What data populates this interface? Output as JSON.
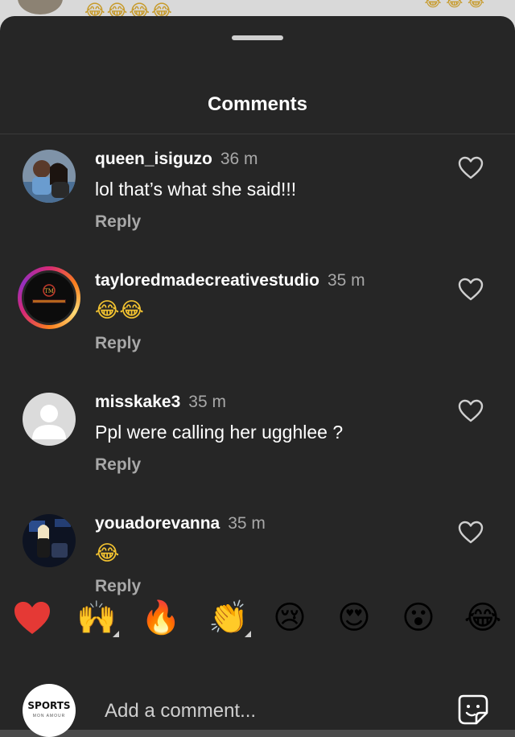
{
  "peek": {
    "emojis_left": "😂😂😂😂",
    "emojis_right": "😂 😂 😂"
  },
  "sheet": {
    "title": "Comments"
  },
  "comments": [
    {
      "username": "queen_isiguzo",
      "time": "36 m",
      "text": "lol that’s what she said!!!",
      "reply_label": "Reply",
      "avatar": "couple-photo"
    },
    {
      "username": "tayloredmadecreativestudio",
      "time": "35 m",
      "text": "😂😂",
      "reply_label": "Reply",
      "avatar": "studio-logo-with-story-ring",
      "avatar_logo_text": "TAYLOREDMADE ART"
    },
    {
      "username": "misskake3",
      "time": "35 m",
      "text": "Ppl were calling her ugghlee ?",
      "reply_label": "Reply",
      "avatar": "default-person"
    },
    {
      "username": "youadorevanna",
      "time": "35 m",
      "text": "😂",
      "reply_label": "Reply",
      "avatar": "studio-photo"
    }
  ],
  "reactions": [
    {
      "emoji": "❤️",
      "name": "red-heart"
    },
    {
      "emoji": "🙌",
      "name": "raised-hands"
    },
    {
      "emoji": "🔥",
      "name": "fire"
    },
    {
      "emoji": "👏",
      "name": "clapping-hands"
    },
    {
      "emoji": "😢",
      "name": "crying-face"
    },
    {
      "emoji": "😍",
      "name": "heart-eyes"
    },
    {
      "emoji": "😮",
      "name": "surprised-face"
    },
    {
      "emoji": "😂",
      "name": "tears-of-joy"
    }
  ],
  "compose": {
    "avatar_brand": "SPORTS",
    "avatar_brand_sub": "MON AMOUR",
    "placeholder": "Add a comment..."
  },
  "colors": {
    "sheet_bg": "#262626",
    "muted_text": "#a8a8a8",
    "heart_reaction": "#e53935"
  }
}
